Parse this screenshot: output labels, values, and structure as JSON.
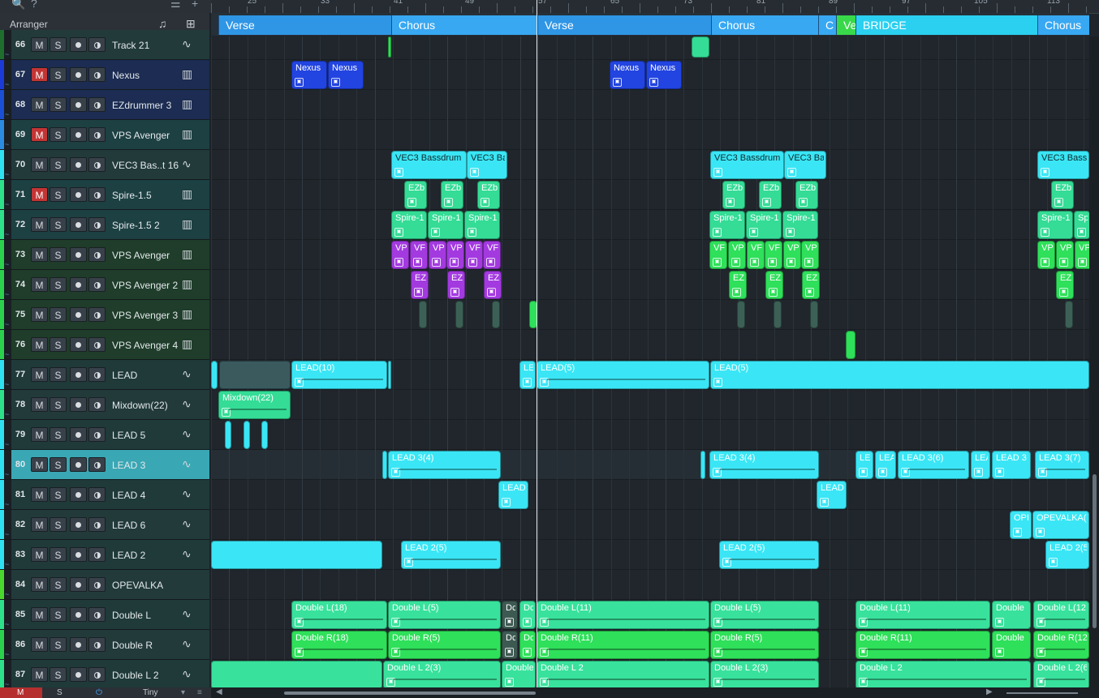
{
  "arranger": {
    "title": "Arranger"
  },
  "ruler": {
    "labels": [
      "25",
      "33",
      "41",
      "49",
      "57",
      "65",
      "73",
      "81",
      "89",
      "97",
      "105",
      "113"
    ]
  },
  "sections": [
    {
      "label": "Verse",
      "color": "#2f96e6"
    },
    {
      "label": "Chorus",
      "color": "#38a8f2"
    },
    {
      "label": "Verse",
      "color": "#2f96e6"
    },
    {
      "label": "Chorus",
      "color": "#38a8f2"
    },
    {
      "label": "C",
      "color": "#38a8f2"
    },
    {
      "label": "Ve",
      "color": "#38d84a"
    },
    {
      "label": "BRIDGE",
      "color": "#2bd0f0"
    },
    {
      "label": "Chorus",
      "color": "#38a8f2"
    }
  ],
  "tracks": [
    {
      "num": "66",
      "name": "Track 21",
      "mute": false,
      "type": "audio",
      "color": "#1e6e2e"
    },
    {
      "num": "67",
      "name": "Nexus",
      "mute": true,
      "type": "instrument",
      "color": "#1b3ad6"
    },
    {
      "num": "68",
      "name": "EZdrummer 3",
      "mute": false,
      "type": "instrument",
      "color": "#1b4fd6"
    },
    {
      "num": "69",
      "name": "VPS Avenger",
      "mute": true,
      "type": "instrument",
      "color": "#2a8be0"
    },
    {
      "num": "70",
      "name": "VEC3 Bas..t 16",
      "mute": false,
      "type": "audio",
      "color": "#2ee0f0"
    },
    {
      "num": "71",
      "name": "Spire-1.5",
      "mute": true,
      "type": "instrument",
      "color": "#2ee08a"
    },
    {
      "num": "72",
      "name": "Spire-1.5 2",
      "mute": false,
      "type": "instrument",
      "color": "#2ee08a"
    },
    {
      "num": "73",
      "name": "VPS Avenger",
      "mute": false,
      "type": "instrument",
      "color": "#2bd04c"
    },
    {
      "num": "74",
      "name": "VPS Avenger 2",
      "mute": false,
      "type": "instrument",
      "color": "#2bd04c"
    },
    {
      "num": "75",
      "name": "VPS Avenger 3",
      "mute": false,
      "type": "instrument",
      "color": "#2bd04c"
    },
    {
      "num": "76",
      "name": "VPS Avenger 4",
      "mute": false,
      "type": "instrument",
      "color": "#2bd04c"
    },
    {
      "num": "77",
      "name": "LEAD",
      "mute": false,
      "type": "audio",
      "color": "#2ee0f0"
    },
    {
      "num": "78",
      "name": "Mixdown(22)",
      "mute": false,
      "type": "audio",
      "color": "#2ee08a"
    },
    {
      "num": "79",
      "name": "LEAD 5",
      "mute": false,
      "type": "audio",
      "color": "#2ee0f0"
    },
    {
      "num": "80",
      "name": "LEAD 3",
      "mute": false,
      "type": "audio",
      "color": "#2ee0f0",
      "selected": true
    },
    {
      "num": "81",
      "name": "LEAD 4",
      "mute": false,
      "type": "audio",
      "color": "#2ee0f0"
    },
    {
      "num": "82",
      "name": "LEAD 6",
      "mute": false,
      "type": "audio",
      "color": "#2ee0f0"
    },
    {
      "num": "83",
      "name": "LEAD 2",
      "mute": false,
      "type": "audio",
      "color": "#2ee0f0"
    },
    {
      "num": "84",
      "name": "OPEVALKA",
      "mute": false,
      "type": "none",
      "color": "#4ad82e"
    },
    {
      "num": "85",
      "name": "Double L",
      "mute": false,
      "type": "audio",
      "color": "#2ee08a"
    },
    {
      "num": "86",
      "name": "Double R",
      "mute": false,
      "type": "audio",
      "color": "#2bd04c"
    },
    {
      "num": "87",
      "name": "Double L 2",
      "mute": false,
      "type": "audio",
      "color": "#2ee08a"
    }
  ],
  "clip_labels": {
    "nexus": "Nexus",
    "vec3": "VEC3 Bassdrum",
    "vec3_short": "VEC3 Ba",
    "vec3_edge": "VEC3 Bass",
    "ezb": "EZb",
    "spire": "Spire-1",
    "spire_edge": "Sp",
    "vp": "VP",
    "vf": "VF",
    "ez": "EZ",
    "lead10": "LEAD(10)",
    "le": "LE",
    "lead5": "LEAD(5)",
    "mixdown": "Mixdown(22)",
    "lead3_4": "LEAD 3(4)",
    "lead3_6": "LEAD 3(6)",
    "lea": "LEA",
    "lead3_short": "LEAD 3",
    "lead3_7": "LEAD 3(7)",
    "lead": "LEAD",
    "opi": "OPI",
    "opevalka": "OPEVALKA(",
    "lead2_5": "LEAD 2(5)",
    "dl18": "Double L(18)",
    "dl5": "Double L(5)",
    "dc": "Dc",
    "dl11": "Double L(11)",
    "double": "Double",
    "dl12": "Double L(12",
    "dr18": "Double R(18)",
    "dr5": "Double R(5)",
    "dr11": "Double R(11)",
    "dr12": "Double R(12",
    "dl2_3": "Double L 2(3)",
    "dl2": "Double L 2",
    "dl2_6": "Double L 2(6"
  },
  "footer": {
    "mute_all": "M",
    "solo_all": "S",
    "size": "Tiny"
  }
}
